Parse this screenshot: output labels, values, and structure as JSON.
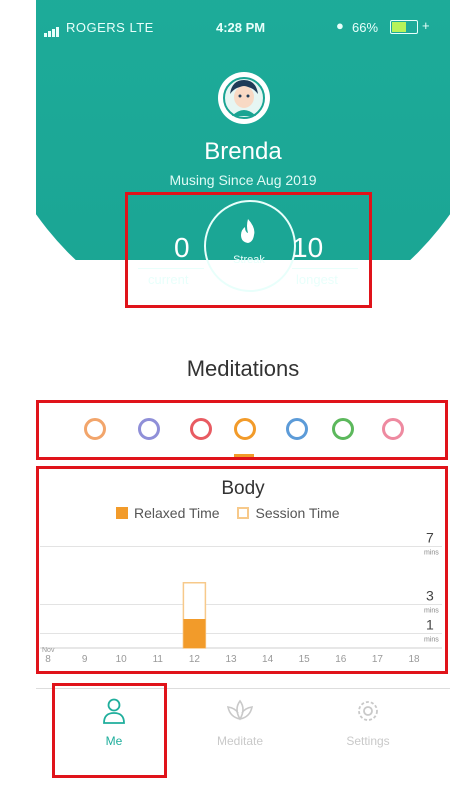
{
  "status_bar": {
    "carrier": "ROGERS LTE",
    "time": "4:28 PM",
    "battery": "66%"
  },
  "profile": {
    "name": "Brenda",
    "subtitle": "Musing Since Aug 2019"
  },
  "streak": {
    "current_value": "0",
    "current_label": "current",
    "center_label": "Streak",
    "longest_value": "10",
    "longest_label": "longest"
  },
  "section": {
    "title": "Meditations"
  },
  "category_icons": [
    {
      "icon": "ring-icon",
      "color": "#f2a56b"
    },
    {
      "icon": "globe-icon",
      "color": "#8f8fd8"
    },
    {
      "icon": "heart-icon",
      "color": "#e85b62"
    },
    {
      "icon": "body-icon",
      "color": "#f29b2a",
      "selected": true
    },
    {
      "icon": "head-icon",
      "color": "#5c9bd8"
    },
    {
      "icon": "leaf-icon",
      "color": "#5cb85c"
    },
    {
      "icon": "pie-icon",
      "color": "#ee8aa0"
    }
  ],
  "chart_data": {
    "type": "bar",
    "title": "Body",
    "series": [
      {
        "name": "Relaxed Time",
        "color": "#f29b2a",
        "values": [
          0,
          0,
          0,
          0,
          2,
          0,
          0,
          0,
          0,
          0,
          0
        ]
      },
      {
        "name": "Session Time",
        "color": "#f7c98a",
        "values": [
          0,
          0,
          0,
          0,
          4.5,
          0,
          0,
          0,
          0,
          0,
          0
        ]
      }
    ],
    "categories": [
      "8",
      "9",
      "10",
      "11",
      "12",
      "13",
      "14",
      "15",
      "16",
      "17",
      "18"
    ],
    "x_prefix_label": "Nov",
    "y_gridlines": [
      {
        "value": 7,
        "label": "7",
        "unit": "mins"
      },
      {
        "value": 3,
        "label": "3",
        "unit": "mins"
      },
      {
        "value": 1,
        "label": "1",
        "unit": "mins"
      }
    ],
    "ylim": [
      0,
      8
    ]
  },
  "tabbar": {
    "tabs": [
      {
        "label": "Me",
        "active": true
      },
      {
        "label": "Meditate",
        "active": false
      },
      {
        "label": "Settings",
        "active": false
      }
    ]
  },
  "colors": {
    "teal": "#1fae9c",
    "accent": "#f29b2a",
    "highlight_box": "#e0131a"
  }
}
